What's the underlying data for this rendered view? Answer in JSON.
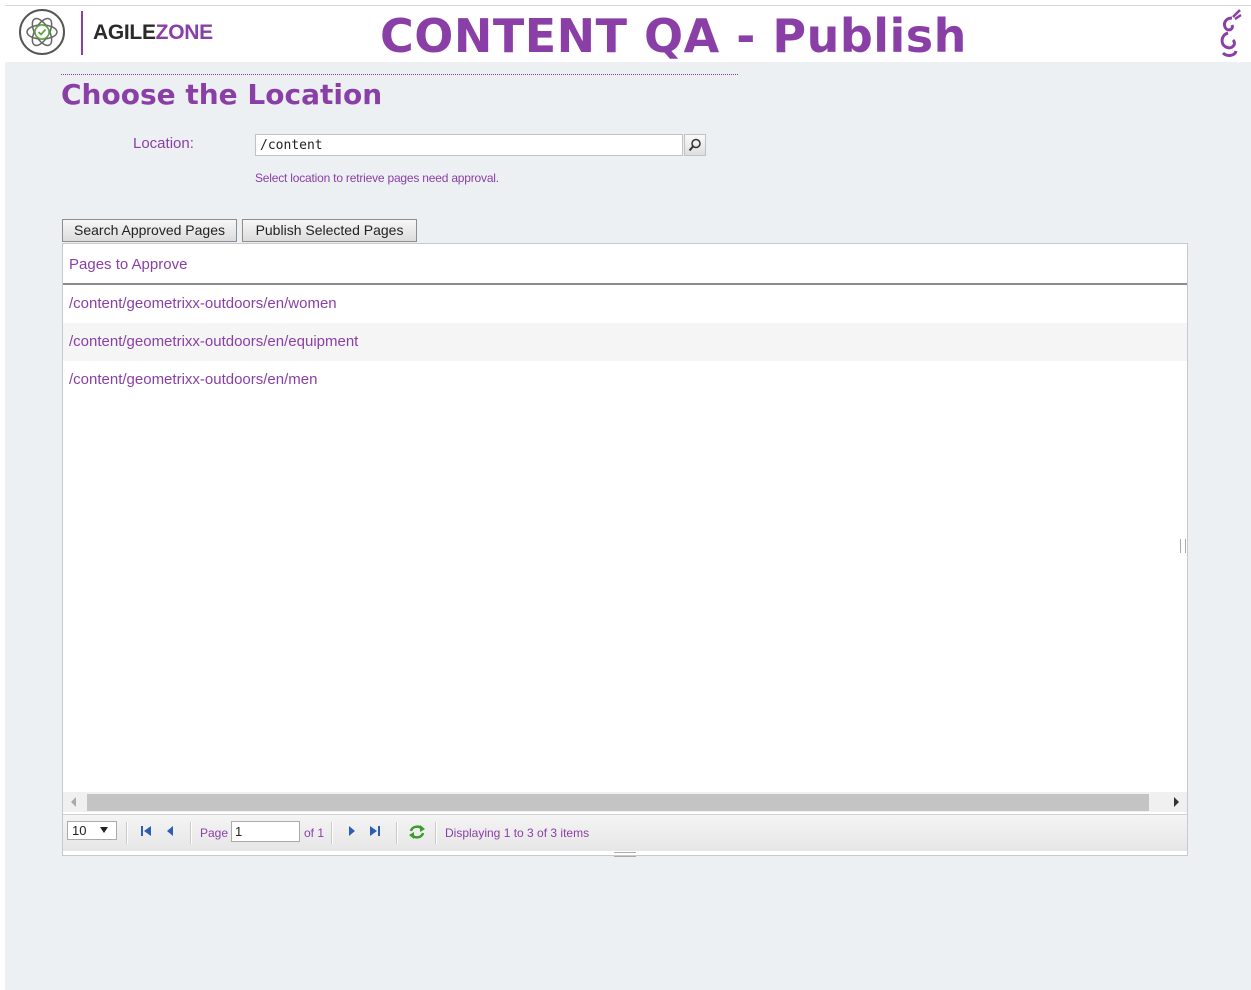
{
  "header": {
    "logo_text_a": "AGILE",
    "logo_text_b": "ZONE",
    "title": "CONTENT QA - Publish",
    "colors": {
      "brand": "#8a3fa7",
      "logo_green": "#5aa63b"
    },
    "icons": [
      "agilezone-logo-icon",
      "brand-corner-icon"
    ]
  },
  "main": {
    "section_title": "Choose the Location",
    "location_label": "Location:",
    "location_value": "/content",
    "location_hint": "Select location to retrieve pages need approval.",
    "search_icon": "magnifier-icon"
  },
  "toolbar": {
    "search_label": "Search Approved Pages",
    "publish_label": "Publish Selected Pages"
  },
  "grid": {
    "column_header": "Pages to Approve",
    "rows": [
      "/content/geometrixx-outdoors/en/women",
      "/content/geometrixx-outdoors/en/equipment",
      "/content/geometrixx-outdoors/en/men"
    ]
  },
  "pager": {
    "page_size": "10",
    "page_label": "Page",
    "page_value": "1",
    "of_label": "of 1",
    "display_text": "Displaying 1 to 3 of 3 items",
    "icons": [
      "first-page-icon",
      "prev-page-icon",
      "next-page-icon",
      "last-page-icon",
      "refresh-icon"
    ]
  }
}
